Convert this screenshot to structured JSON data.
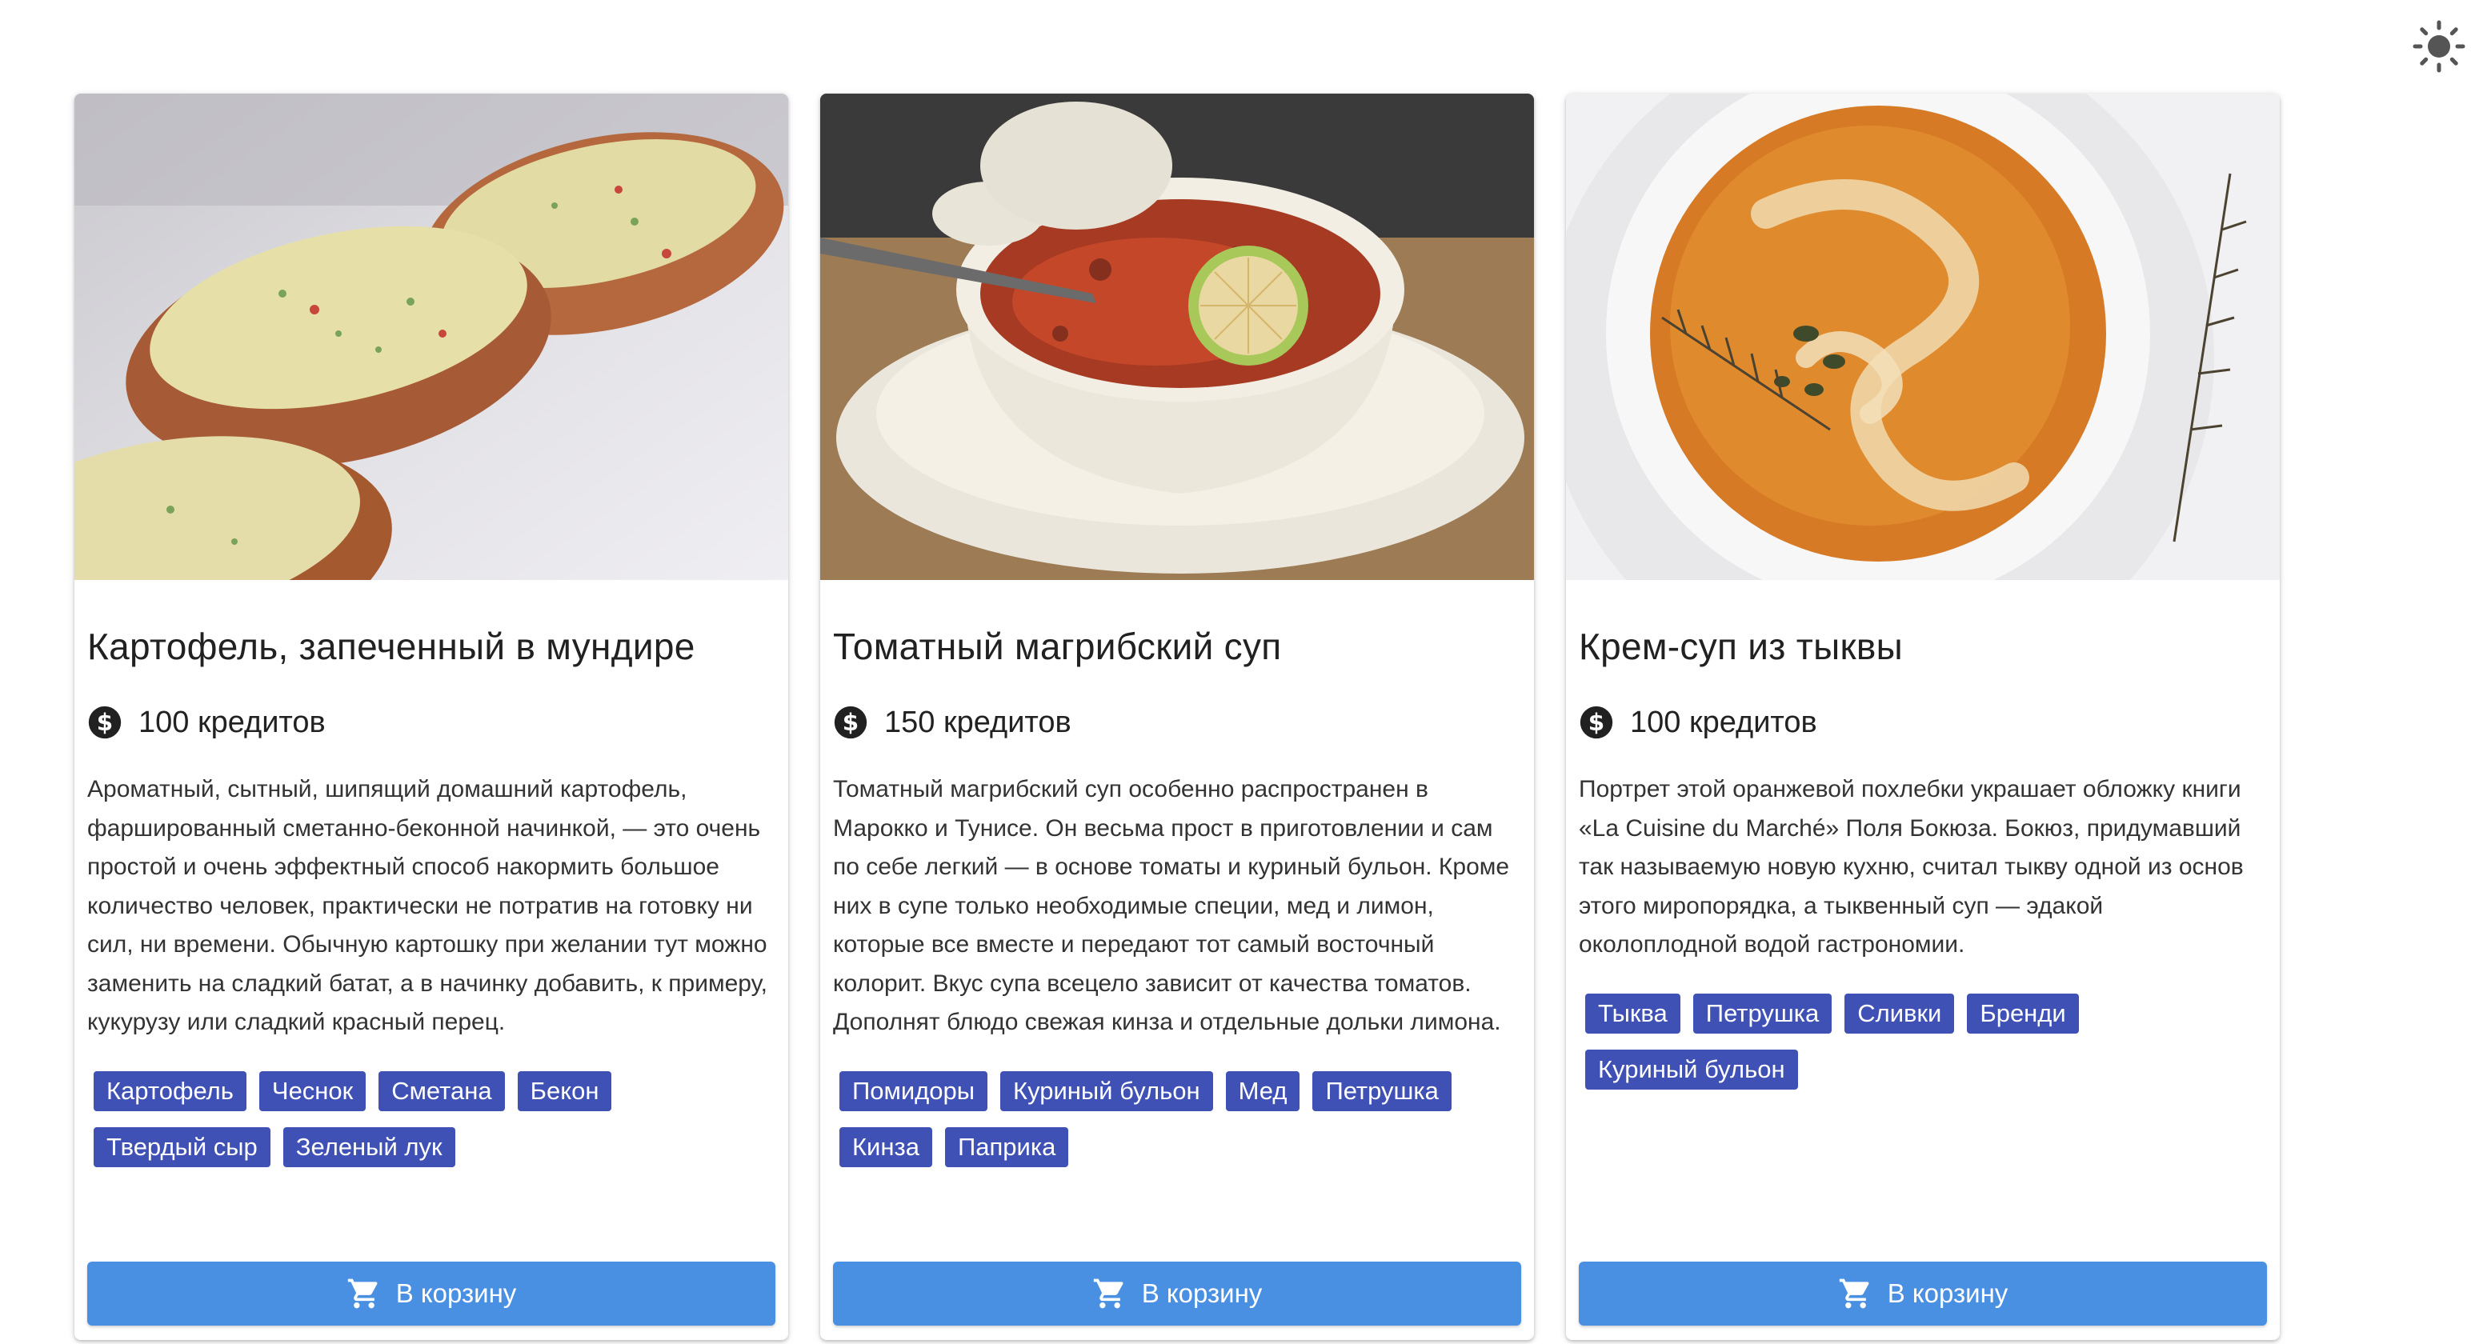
{
  "theme_toggle": {
    "icon": "sun-icon"
  },
  "cards": [
    {
      "image_alt": "Картофель, запеченный в мундире",
      "title": "Картофель, запеченный в мундире",
      "price": "100 кредитов",
      "description": "Ароматный, сытный, шипящий домашний картофель, фаршированный сметанно-беконной начинкой, — это очень простой и очень эффектный способ накормить большое количество человек, практически не потратив на готовку ни сил, ни времени. Обычную картошку при желании тут можно заменить на сладкий батат, а в начинку добавить, к примеру, кукурузу или сладкий красный перец.",
      "tags": [
        "Картофель",
        "Чеснок",
        "Сметана",
        "Бекон",
        "Твердый сыр",
        "Зеленый лук"
      ],
      "button": "В корзину"
    },
    {
      "image_alt": "Томатный магрибский суп",
      "title": "Томатный магрибский суп",
      "price": "150 кредитов",
      "description": "Томатный магрибский суп особенно распространен в Марокко и Тунисе. Он весьма прост в приготовлении и сам по себе легкий — в основе томаты и куриный бульон. Кроме них в супе только необходимые специи, мед и лимон, которые все вместе и передают тот самый восточный колорит. Вкус супа всецело зависит от качества томатов. Дополнят блюдо свежая кинза и отдельные дольки лимона.",
      "tags": [
        "Помидоры",
        "Куриный бульон",
        "Мед",
        "Петрушка",
        "Кинза",
        "Паприка"
      ],
      "button": "В корзину"
    },
    {
      "image_alt": "Крем-суп из тыквы",
      "title": "Крем-суп из тыквы",
      "price": "100 кредитов",
      "description": "Портрет этой оранжевой похлебки украшает обложку книги «La Cuisine du Marché» Поля Бокюза. Бокюз, придумавший так называемую новую кухню, считал тыкву одной из основ этого миропорядка, а тыквенный суп — эдакой околоплодной водой гастрономии.",
      "tags": [
        "Тыква",
        "Петрушка",
        "Сливки",
        "Бренди",
        "Куриный бульон"
      ],
      "button": "В корзину"
    }
  ],
  "colors": {
    "tag_bg": "#3f51b5",
    "button_bg": "#4a90e2",
    "text": "#212121"
  }
}
